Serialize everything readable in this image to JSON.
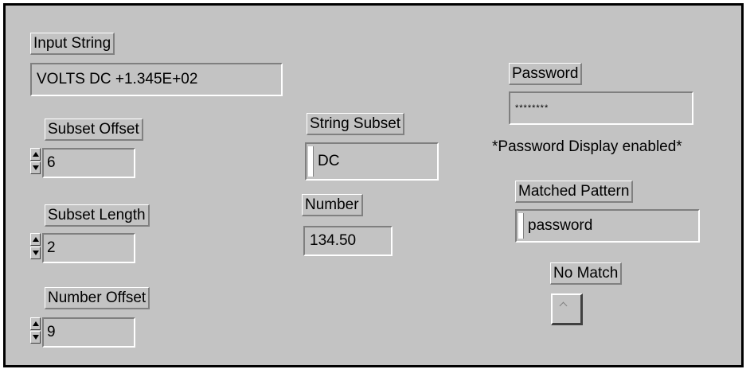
{
  "controls": {
    "input_string": {
      "label": "Input String",
      "value": "VOLTS DC +1.345E+02"
    },
    "subset_offset": {
      "label": "Subset Offset",
      "value": "6"
    },
    "subset_length": {
      "label": "Subset Length",
      "value": "2"
    },
    "number_offset": {
      "label": "Number Offset",
      "value": "9"
    },
    "password": {
      "label": "Password",
      "value": "********"
    }
  },
  "indicators": {
    "string_subset": {
      "label": "String Subset",
      "value": "DC"
    },
    "number": {
      "label": "Number",
      "value": "134.50"
    },
    "matched_pattern": {
      "label": "Matched Pattern",
      "value": "password"
    },
    "no_match": {
      "label": "No Match",
      "state": false
    }
  },
  "notes": {
    "password_display": "*Password Display enabled*"
  },
  "colors": {
    "panel_bg": "#c3c3c3",
    "frame": "#000000"
  }
}
